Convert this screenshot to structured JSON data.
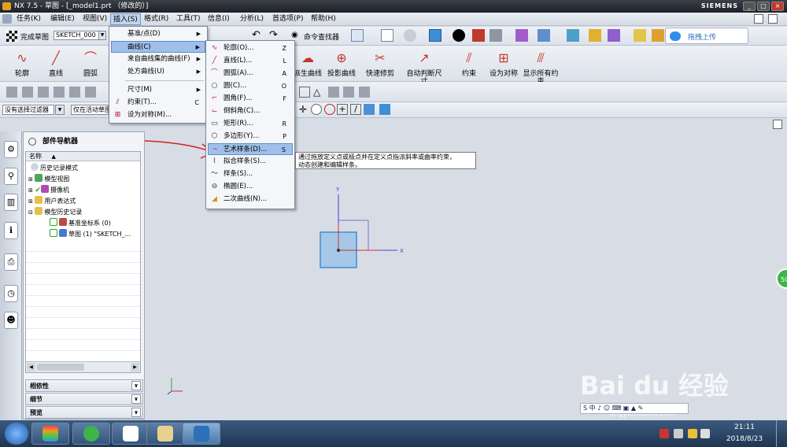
{
  "window": {
    "title": "NX 7.5 - 草图 - [_model1.prt （修改的）]",
    "brand": "SIEMENS",
    "upload_label": "拖拽上传"
  },
  "menubar": {
    "items": [
      "任务(K)",
      "编辑(E)",
      "视图(V)",
      "插入(S)",
      "格式(R)",
      "工具(T)",
      "信息(I)",
      "分析(L)",
      "首选项(P)",
      "帮助(H)"
    ]
  },
  "toolbar": {
    "finish_sketch": "完成草图",
    "sketch_name": "SKETCH_000",
    "command_finder": "命令查找器"
  },
  "sketch_tools": [
    {
      "label": "轮廓"
    },
    {
      "label": "直线"
    },
    {
      "label": "圆弧"
    }
  ],
  "right_tools": [
    {
      "label": "派生曲线"
    },
    {
      "label": "投影曲线"
    },
    {
      "label": "快速修剪"
    },
    {
      "label": "自动判断尺寸"
    },
    {
      "label": "约束"
    },
    {
      "label": "设为对称"
    },
    {
      "label": "显示所有约束"
    }
  ],
  "filter": {
    "selection": "没有选择过滤器",
    "scope": "仅在活动草图"
  },
  "insert_menu": {
    "items": [
      {
        "label": "基准/点(D)",
        "submenu": true
      },
      {
        "label": "曲线(C)",
        "submenu": true,
        "highlight": true
      },
      {
        "label": "来自曲线集的曲线(F)",
        "submenu": true
      },
      {
        "label": "处方曲线(U)",
        "submenu": true
      },
      {
        "label": "尺寸(M)",
        "submenu": true
      },
      {
        "label": "约束(T)...",
        "key": "C"
      },
      {
        "label": "设为对称(M)..."
      }
    ]
  },
  "curve_menu": {
    "items": [
      {
        "label": "轮廓(O)...",
        "key": "Z"
      },
      {
        "label": "直线(L)...",
        "key": "L"
      },
      {
        "label": "圆弧(A)...",
        "key": "A"
      },
      {
        "label": "圆(C)...",
        "key": "O"
      },
      {
        "label": "圆角(F)...",
        "key": "F"
      },
      {
        "label": "倒斜角(C)..."
      },
      {
        "label": "矩形(R)...",
        "key": "R"
      },
      {
        "label": "多边形(Y)...",
        "key": "P"
      },
      {
        "label": "艺术样条(D)...",
        "key": "S",
        "highlight": true
      },
      {
        "label": "拟合样条(S)..."
      },
      {
        "label": "样条(S)..."
      },
      {
        "label": "椭圆(E)..."
      },
      {
        "label": "二次曲线(N)..."
      }
    ]
  },
  "tooltip": {
    "line1": "通过拖放定义点或极点并在定义点指派斜率或曲率约束，",
    "line2": "动态创建和编辑样条。"
  },
  "navigator": {
    "title": "部件导航器",
    "column": "名称",
    "rows": [
      {
        "label": "历史记录模式"
      },
      {
        "label": "模型视图"
      },
      {
        "label": "摄像机"
      },
      {
        "label": "用户表达式"
      },
      {
        "label": "模型历史记录"
      },
      {
        "label": "基准坐标系 (0)"
      },
      {
        "label": "草图 (1) \"SKETCH_..."
      }
    ],
    "panels": [
      "相依性",
      "细节",
      "预览"
    ]
  },
  "watermark": {
    "text": "Bai du 经验",
    "url": "jingyan.baidu.com"
  },
  "tray": {
    "time": "21:11",
    "date": "2018/8/23"
  },
  "badge": {
    "value": "50"
  },
  "colors": {
    "accent": "#6c93c6",
    "highlight": "#9fc0ea",
    "arrow": "#d22020"
  }
}
